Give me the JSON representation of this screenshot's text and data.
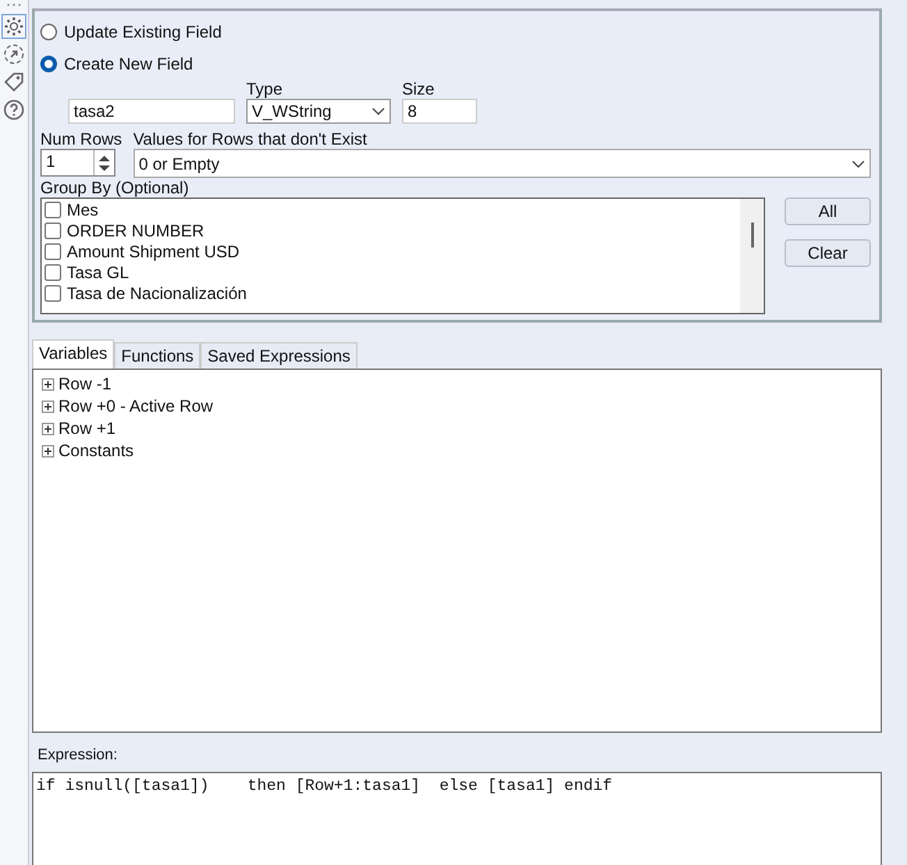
{
  "mode_options": [
    {
      "label": "Update Existing Field",
      "selected": false
    },
    {
      "label": "Create New  Field",
      "selected": true
    }
  ],
  "field": {
    "name": "tasa2",
    "type_label": "Type",
    "type": "V_WString",
    "size_label": "Size",
    "size": "8"
  },
  "num_rows": {
    "label": "Num Rows",
    "value": "1"
  },
  "missing_values": {
    "label": "Values for Rows that don't Exist",
    "value": "0 or Empty"
  },
  "group_by": {
    "label": "Group By (Optional)",
    "items": [
      {
        "label": "Mes",
        "checked": false
      },
      {
        "label": "ORDER NUMBER",
        "checked": false
      },
      {
        "label": "Amount Shipment USD",
        "checked": false
      },
      {
        "label": "Tasa GL",
        "checked": false
      },
      {
        "label": "Tasa de Nacionalización",
        "checked": false
      }
    ],
    "buttons": [
      "All",
      "Clear"
    ]
  },
  "tabs": [
    {
      "label": "Variables",
      "selected": true
    },
    {
      "label": "Functions",
      "selected": false
    },
    {
      "label": "Saved Expressions",
      "selected": false
    }
  ],
  "tree": [
    {
      "label": "Row -1",
      "expanded": false
    },
    {
      "label": "Row +0 - Active Row",
      "expanded": false
    },
    {
      "label": "Row +1",
      "expanded": false
    },
    {
      "label": "Constants",
      "expanded": false
    }
  ],
  "expression": {
    "label": "Expression:",
    "value": "if isnull([tasa1])    then [Row+1:tasa1]  else [tasa1] endif"
  }
}
